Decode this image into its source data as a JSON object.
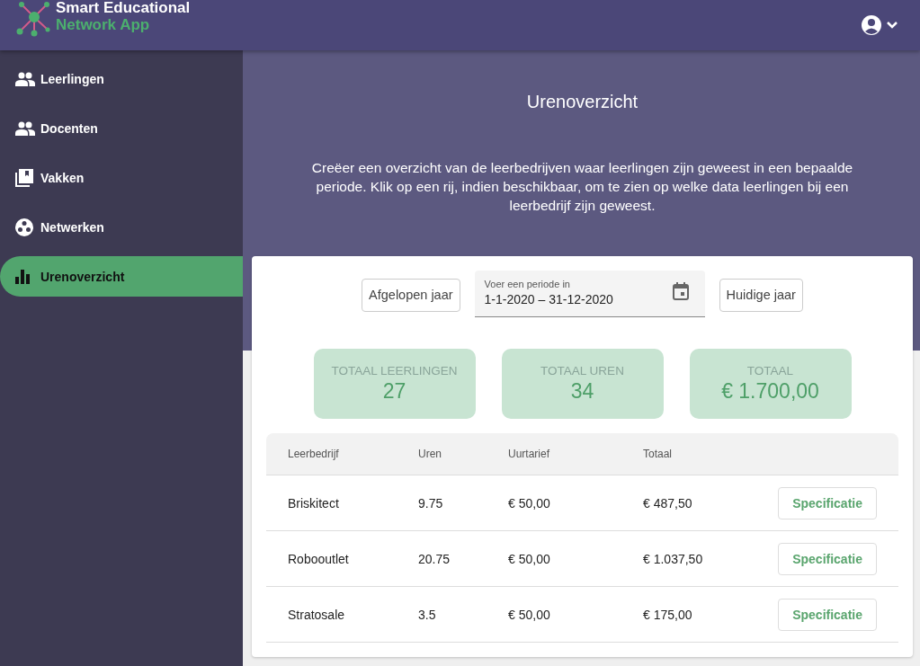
{
  "header": {
    "title_line_1": "Smart Educational",
    "title_line_2": "Network App"
  },
  "sidebar": {
    "items": [
      {
        "label": "Leerlingen",
        "selected": false
      },
      {
        "label": "Docenten",
        "selected": false
      },
      {
        "label": "Vakken",
        "selected": false
      },
      {
        "label": "Netwerken",
        "selected": false
      },
      {
        "label": "Urenoverzicht",
        "selected": true
      }
    ]
  },
  "page": {
    "title": "Urenoverzicht",
    "description": "Creëer een overzicht van de leerbedrijven waar leerlingen zijn geweest in een bepaalde periode. Klik op een rij, indien beschikbaar, om te zien op welke data leerlingen bij een leerbedrijf zijn geweest."
  },
  "filters": {
    "previous_button": "Afgelopen jaar",
    "period_field": {
      "label": "Voer een periode in",
      "value": "1-1-2020 – 31-12-2020"
    },
    "current_button": "Huidige jaar"
  },
  "stats": [
    {
      "label": "TOTAAL LEERLINGEN",
      "value": "27"
    },
    {
      "label": "TOTAAL UREN",
      "value": "34"
    },
    {
      "label": "TOTAAL",
      "value": "€ 1.700,00"
    }
  ],
  "table": {
    "columns": [
      "Leerbedrijf",
      "Uren",
      "Uurtarief",
      "Totaal"
    ],
    "rows": [
      {
        "cells": [
          "Briskitect",
          "9.75",
          "€ 50,00",
          "€ 487,50"
        ],
        "action": "Specificatie"
      },
      {
        "cells": [
          "Robooutlet",
          "20.75",
          "€ 50,00",
          "€ 1.037,50"
        ],
        "action": "Specificatie"
      },
      {
        "cells": [
          "Stratosale",
          "3.5",
          "€ 50,00",
          "€ 175,00"
        ],
        "action": "Specificatie"
      }
    ]
  }
}
